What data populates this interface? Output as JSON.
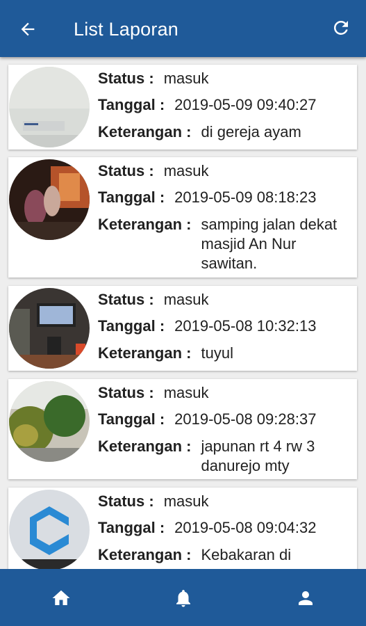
{
  "appbar": {
    "title": "List Laporan",
    "back_icon": "arrow-left-icon",
    "refresh_icon": "refresh-icon",
    "color": "#1f5a99"
  },
  "labels": {
    "status": "Status :",
    "tanggal": "Tanggal :",
    "keterangan": "Keterangan :"
  },
  "reports": [
    {
      "status": "masuk",
      "tanggal": "2019-05-09 09:40:27",
      "keterangan": "di gereja ayam"
    },
    {
      "status": "masuk",
      "tanggal": "2019-05-09 08:18:23",
      "keterangan": "samping jalan dekat masjid An Nur sawitan."
    },
    {
      "status": "masuk",
      "tanggal": "2019-05-08 10:32:13",
      "keterangan": "tuyul"
    },
    {
      "status": "masuk",
      "tanggal": "2019-05-08 09:28:37",
      "keterangan": "japunan rt 4 rw 3 danurejo mty"
    },
    {
      "status": "masuk",
      "tanggal": "2019-05-08 09:04:32",
      "keterangan": "Kebakaran di"
    }
  ],
  "bottom_nav": [
    {
      "icon": "home-icon"
    },
    {
      "icon": "bell-icon"
    },
    {
      "icon": "person-icon"
    }
  ]
}
